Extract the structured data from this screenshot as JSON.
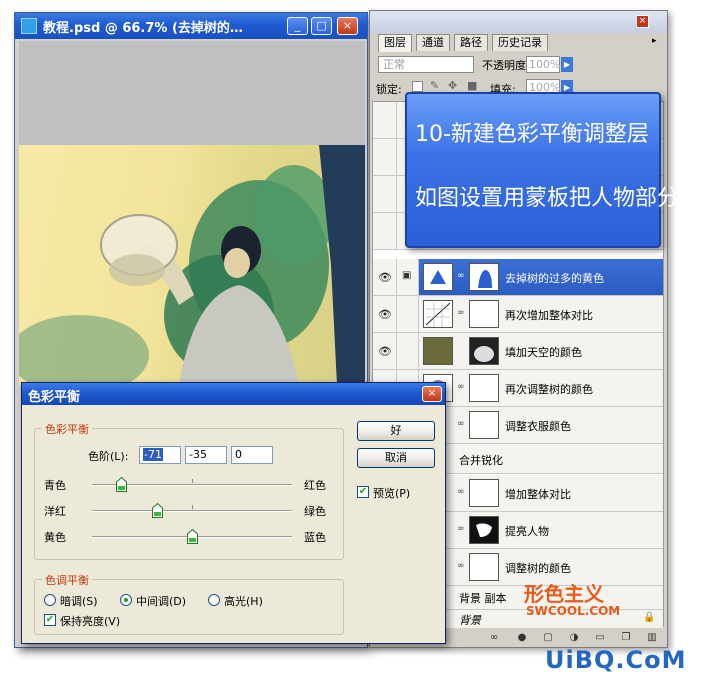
{
  "document": {
    "title": "教程.psd @ 66.7% (去掉树的…",
    "minimize": "_",
    "maximize": "□",
    "close": "×"
  },
  "layers_panel": {
    "tabs": [
      "图层",
      "通道",
      "路径",
      "历史记录"
    ],
    "blend_mode": "正常",
    "opacity_label": "不透明度:",
    "opacity_value": "100%",
    "lock_label": "锁定:",
    "fill_label": "填充:",
    "fill_value": "100%",
    "layers": [
      {
        "name": "去掉树的过多的黄色",
        "selected": true
      },
      {
        "name": "再次增加整体对比"
      },
      {
        "name": "填加天空的颜色"
      },
      {
        "name": "再次调整树的颜色"
      },
      {
        "name": "调整衣服颜色"
      },
      {
        "name": "合并锐化"
      },
      {
        "name": "增加整体对比"
      },
      {
        "name": "提亮人物"
      },
      {
        "name": "调整树的颜色"
      },
      {
        "name": "背景 副本"
      },
      {
        "name": "背景"
      }
    ]
  },
  "callout": {
    "line1": "10-新建色彩平衡调整层",
    "line2": "如图设置用蒙板把人物部分擦掉"
  },
  "color_balance": {
    "title": "色彩平衡",
    "close": "×",
    "group1_title": "色彩平衡",
    "levels_label": "色阶(L):",
    "levels": [
      "-71",
      "-35",
      "0"
    ],
    "sliders": [
      {
        "left": "青色",
        "right": "红色",
        "value": -71
      },
      {
        "left": "洋红",
        "right": "绿色",
        "value": -35
      },
      {
        "left": "黄色",
        "right": "蓝色",
        "value": 0
      }
    ],
    "group2_title": "色调平衡",
    "tones": [
      "暗调(S)",
      "中间调(D)",
      "高光(H)"
    ],
    "tone_selected": "中间调(D)",
    "preserve_label": "保持亮度(V)",
    "ok_label": "好",
    "cancel_label": "取消",
    "preview_label": "预览(P)"
  },
  "watermarks": {
    "logo": "形色主义",
    "domain": "SWCOOL.COM",
    "site": "UiBQ.CoM"
  }
}
